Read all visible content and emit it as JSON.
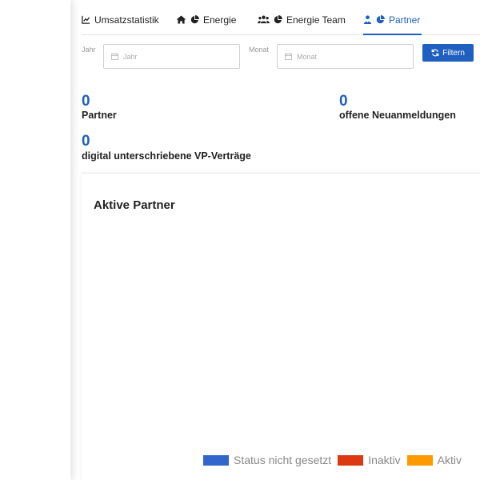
{
  "tabs": [
    {
      "label": "Umsatzstatistik",
      "active": false
    },
    {
      "label": "Energie",
      "active": false
    },
    {
      "label": "Energie Team",
      "active": false
    },
    {
      "label": "Partner",
      "active": true
    }
  ],
  "filter": {
    "year_label": "Jahr",
    "year_placeholder": "Jahr",
    "month_label": "Monat",
    "month_placeholder": "Monat",
    "button_label": "Filtern"
  },
  "stats": {
    "partner": {
      "value": "0",
      "label": "Partner"
    },
    "neuanmeldungen": {
      "value": "0",
      "label": "offene Neuanmeldungen"
    },
    "vp_vertraege": {
      "value": "0",
      "label": "digital unterschriebene VP-Verträge"
    }
  },
  "card": {
    "title": "Aktive Partner"
  },
  "chart_data": {
    "type": "pie",
    "title": "Aktive Partner",
    "series": [
      {
        "name": "Status nicht gesetzt",
        "value": 0,
        "color": "#3366cc"
      },
      {
        "name": "Inaktiv",
        "value": 0,
        "color": "#dc3912"
      },
      {
        "name": "Aktiv",
        "value": 0,
        "color": "#ff9900"
      }
    ],
    "legend": "bottom"
  },
  "colors": {
    "accent": "#1f5fbf"
  }
}
